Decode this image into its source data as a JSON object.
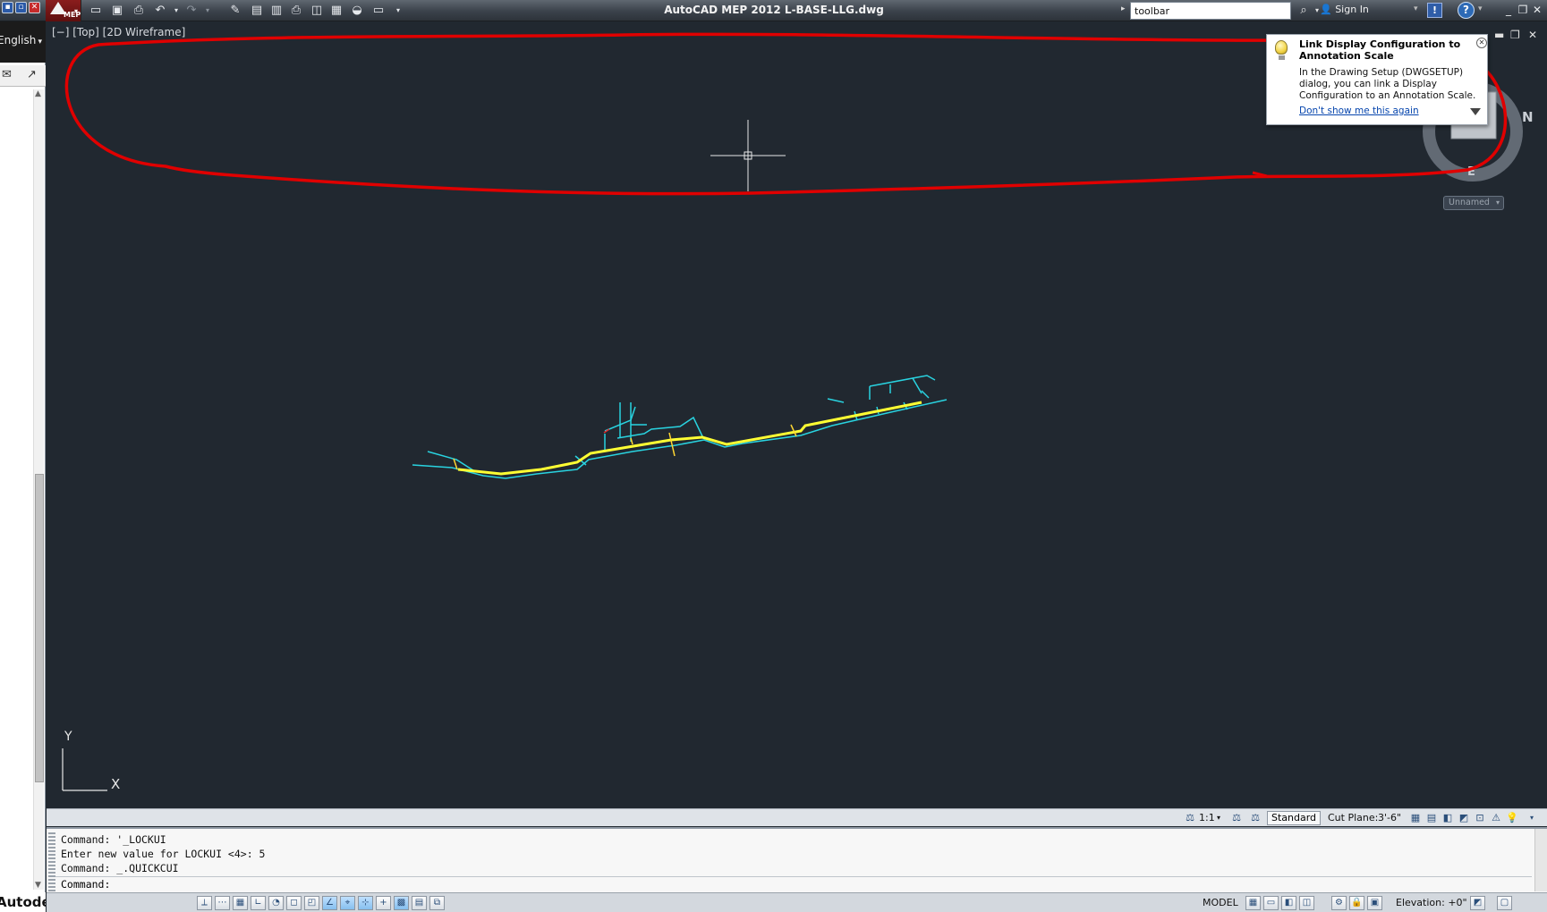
{
  "titlebar": {
    "app_logo_text": "MEP",
    "title": "AutoCAD MEP 2012   L-BASE-LLG.dwg",
    "search_value": "toolbar",
    "sign_in": "Sign In",
    "exchange_icon_text": "!",
    "help_icon_text": "?"
  },
  "left_panel": {
    "language": "English",
    "brand": "Autodesk"
  },
  "viewport": {
    "label": "[−] [Top] [2D Wireframe]",
    "compass_letters": {
      "north": "N",
      "east": "E"
    },
    "view_name": "Unnamed",
    "ucs": {
      "y_label": "Y",
      "x_label": "X"
    }
  },
  "balloon": {
    "title": "Link Display Configuration to Annotation Scale",
    "body": "In the Drawing Setup (DWGSETUP) dialog, you can link a Display Configuration to an Annotation Scale.",
    "link": "Don't show me this again"
  },
  "drawing_status": {
    "annotation_scale": "1:1",
    "display_config": "Standard",
    "cut_plane_label": "Cut Plane:",
    "cut_plane_value": "3'-6\""
  },
  "command_line": {
    "history": [
      "Command: '_LOCKUI",
      "Enter new value for LOCKUI <4>: 5",
      "Command: _.QUICKCUI"
    ],
    "prompt": "Command:"
  },
  "status_bar": {
    "model_label": "MODEL",
    "elevation_label": "Elevation:",
    "elevation_value": "+0\""
  },
  "colors": {
    "viewport_bg": "#212830",
    "highlight_red": "#e00000",
    "pipe_cyan": "#29d3e0",
    "pipe_yellow": "#ffff33"
  }
}
